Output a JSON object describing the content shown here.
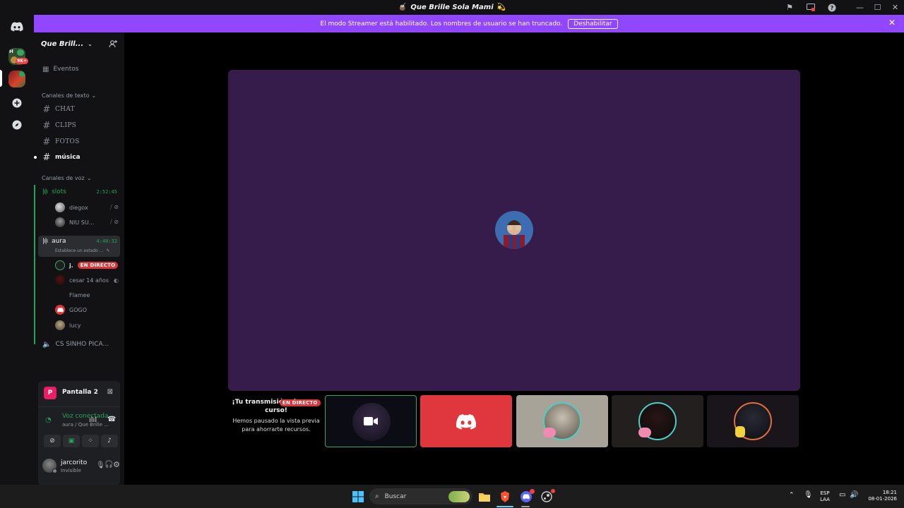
{
  "window": {
    "title": "Que Brille Sola Mami",
    "title_emoji_left": "🧉",
    "title_emoji_right": "💫"
  },
  "banner": {
    "message": "El modo Streamer está habilitado. Los nombres de usuario se han truncado.",
    "button": "Deshabilitar"
  },
  "rail": {
    "badge": "9K+",
    "server_initial": "H"
  },
  "server": {
    "name": "Que Brill..."
  },
  "channels": {
    "events_label": "Eventos",
    "text_category": "Canales de texto",
    "text": [
      {
        "name": "CHAT"
      },
      {
        "name": "CLIPS"
      },
      {
        "name": "FOTOS"
      },
      {
        "name": "música"
      }
    ],
    "voice_category": "Canales de voz",
    "voice": {
      "slots": {
        "name": "slots",
        "timer": "2:52:45",
        "users": [
          "diegox",
          "NIU SU..."
        ]
      },
      "aura": {
        "name": "aura",
        "timer": "4:40:32",
        "status": "Establece un estado ...",
        "users": [
          "j.",
          "cesar 14 años",
          "Flamee",
          "GOGO",
          "lucy"
        ]
      },
      "other": "CS SINHO PICA..."
    },
    "live_badge": "EN DIRECTO"
  },
  "screenshare": {
    "name": "Pantalla 2",
    "initial": "P"
  },
  "voice_panel": {
    "status": "Voz conectada",
    "sub": "aura / Que Brille ..."
  },
  "user": {
    "name": "jarcorito",
    "status": "Invisible"
  },
  "stage": {
    "live_badge": "EN DIRECTO",
    "note_title": "¡Tu transmisión sigue en curso!",
    "note_body": "Hemos pausado la vista previa para ahorrarte recursos."
  },
  "taskbar": {
    "search_placeholder": "Buscar",
    "lang": "ESP",
    "layout": "LAA",
    "time": "18:21",
    "date": "08-01-2026"
  },
  "colors": {
    "banner": "#9147ff",
    "tile": "#351c4b",
    "discord_red": "#da373c",
    "connected": "#23a55a"
  }
}
